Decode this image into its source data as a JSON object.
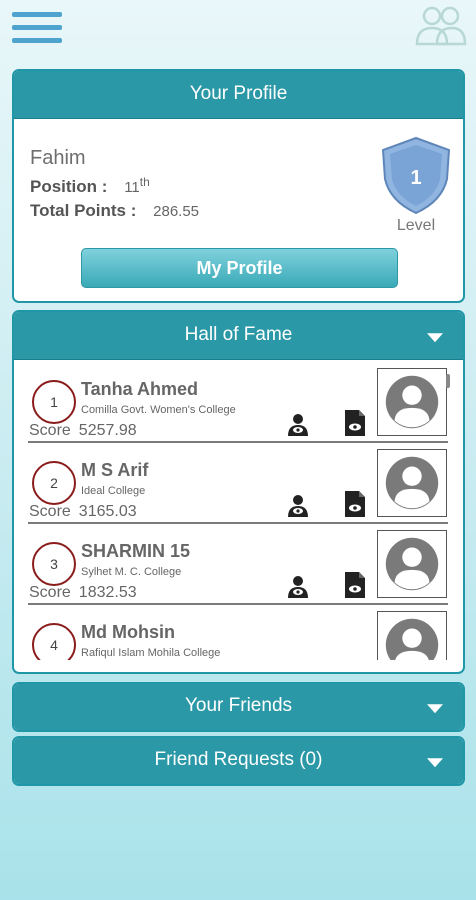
{
  "topbar": {
    "menu_icon": "hamburger-menu-icon",
    "friends_icon": "friends-group-icon"
  },
  "profile": {
    "header": "Your Profile",
    "name": "Fahim",
    "position_label": "Position :",
    "position_value": "11",
    "position_suffix": "th",
    "points_label": "Total Points :",
    "points_value": "286.55",
    "level_value": "1",
    "level_label": "Level",
    "button_label": "My Profile"
  },
  "hall_of_fame": {
    "header": "Hall of Fame",
    "score_label": "Score",
    "entries": [
      {
        "rank": "1",
        "name": "Tanha Ahmed",
        "college": "Comilla Govt. Women's College",
        "score": "5257.98"
      },
      {
        "rank": "2",
        "name": "M S  Arif",
        "college": "Ideal College",
        "score": "3165.03"
      },
      {
        "rank": "3",
        "name": "SHARMIN 15",
        "college": "Sylhet M. C. College",
        "score": "1832.53"
      },
      {
        "rank": "4",
        "name": "Md Mohsin",
        "college": "Rafiqul Islam Mohila College",
        "score": ""
      }
    ]
  },
  "friends": {
    "header": "Your Friends"
  },
  "requests": {
    "header": "Friend Requests (0)"
  },
  "colors": {
    "accent": "#2a98a6",
    "border": "#1f97a6",
    "rank_circle": "#8a1c1c",
    "level_shield": "#7aa3d6"
  }
}
